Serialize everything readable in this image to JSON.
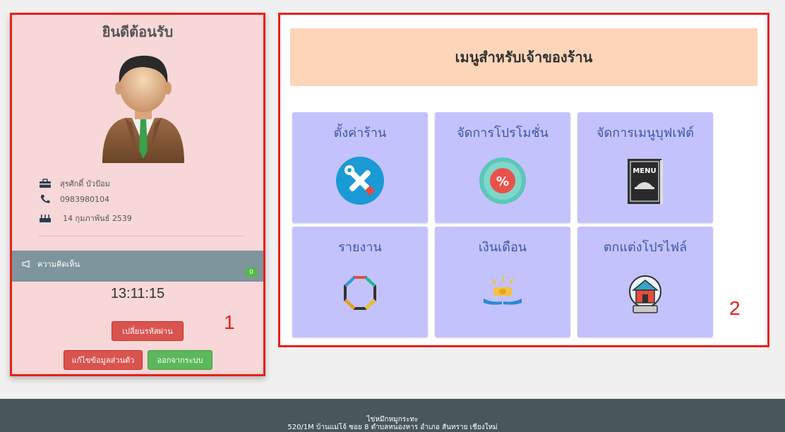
{
  "profile": {
    "welcome": "ยินดีต้อนรับ",
    "name": "สุรศักดิ์ บัวป้อม",
    "phone": "0983980104",
    "birthday": "14 กุมภาพันธ์ 2539"
  },
  "comments": {
    "label": "ความคิดเห็น",
    "count": "0"
  },
  "clock": "13:11:15",
  "buttons": {
    "change_password": "เปลี่ยนรหัสผ่าน",
    "edit_profile": "แก้ไขข้อมูลส่วนตัว",
    "logout": "ออกจากระบบ"
  },
  "markers": {
    "left": "1",
    "right": "2"
  },
  "menu": {
    "title": "เมนูสำหรับเจ้าของร้าน",
    "tiles": [
      {
        "label": "ตั้งค่าร้าน",
        "icon": "tools-icon"
      },
      {
        "label": "จัดการโปรโมชั่น",
        "icon": "promotion-badge-icon"
      },
      {
        "label": "จัดการเมนูบุฟเฟ่ต์",
        "icon": "menu-book-icon"
      },
      {
        "label": "รายงาน",
        "icon": "report-cycle-icon"
      },
      {
        "label": "เงินเดือน",
        "icon": "salary-money-icon"
      },
      {
        "label": "ตกแต่งโปรไฟล์",
        "icon": "profile-house-icon"
      }
    ],
    "menu_book_text": "MENU"
  },
  "colors": {
    "left_bg": "#f7d7d7",
    "tile_bg": "#c4c2fc",
    "header_bg": "#fdd5b8",
    "accent_red": "#e8201b",
    "button_red": "#d9534f",
    "button_green": "#5cb85c",
    "footer_bg": "#48575c"
  },
  "footer": {
    "line1": "ไข่หมึกหมูกระทะ",
    "line2": "520/1M บ้านแม่โจ้ ซอย 8 ตำบลหนองหาร อำเภอ สันทราย เชียงใหม่"
  }
}
